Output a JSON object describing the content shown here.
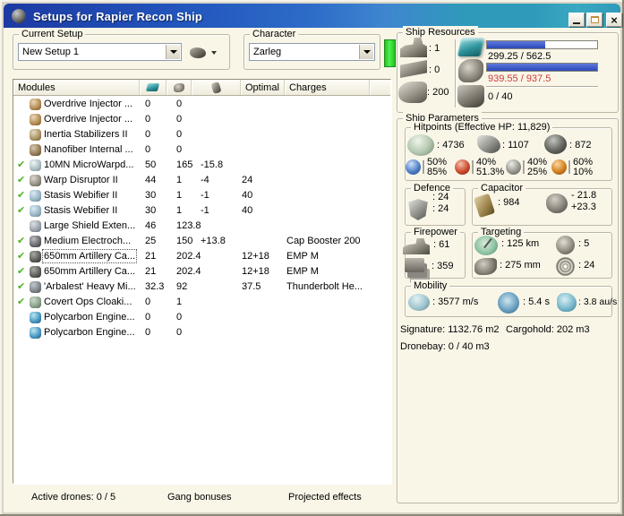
{
  "glyphs": {
    "check": "✔",
    "close": "×"
  },
  "window": {
    "title": "Setups for Rapier Recon Ship"
  },
  "setup_panel": {
    "label": "Current Setup",
    "value": "New Setup 1"
  },
  "character_panel": {
    "label": "Character",
    "value": "Zarleg"
  },
  "modules_table": {
    "header": {
      "modules": "Modules",
      "optimal": "Optimal",
      "charges": "Charges"
    },
    "rows": [
      {
        "icon": "overdrive-injector",
        "name": "Overdrive Injector ...",
        "cpu": "0",
        "pg": "0",
        "cap": "",
        "optimal": "",
        "charges": "",
        "active": false
      },
      {
        "icon": "overdrive-injector",
        "name": "Overdrive Injector ...",
        "cpu": "0",
        "pg": "0",
        "cap": "",
        "optimal": "",
        "charges": "",
        "active": false
      },
      {
        "icon": "inertia-stabilizers",
        "name": "Inertia Stabilizers II",
        "cpu": "0",
        "pg": "0",
        "cap": "",
        "optimal": "",
        "charges": "",
        "active": false
      },
      {
        "icon": "nanofiber-structure",
        "name": "Nanofiber Internal ...",
        "cpu": "0",
        "pg": "0",
        "cap": "",
        "optimal": "",
        "charges": "",
        "active": false
      },
      {
        "icon": "microwarpdrive",
        "name": "10MN MicroWarpd...",
        "cpu": "50",
        "pg": "165",
        "cap": "-15.8",
        "optimal": "",
        "charges": "",
        "active": true
      },
      {
        "icon": "warp-disruptor",
        "name": "Warp Disruptor II",
        "cpu": "44",
        "pg": "1",
        "cap": "-4",
        "optimal": "24",
        "charges": "",
        "active": true
      },
      {
        "icon": "stasis-webifier",
        "name": "Stasis Webifier II",
        "cpu": "30",
        "pg": "1",
        "cap": "-1",
        "optimal": "40",
        "charges": "",
        "active": true
      },
      {
        "icon": "stasis-webifier",
        "name": "Stasis Webifier II",
        "cpu": "30",
        "pg": "1",
        "cap": "-1",
        "optimal": "40",
        "charges": "",
        "active": true
      },
      {
        "icon": "shield-extender",
        "name": "Large Shield Exten...",
        "cpu": "46",
        "pg": "123.8",
        "cap": "",
        "optimal": "",
        "charges": "",
        "active": false
      },
      {
        "icon": "cap-booster",
        "name": "Medium Electroch...",
        "cpu": "25",
        "pg": "150",
        "cap": "+13.8",
        "optimal": "",
        "charges": "Cap Booster 200",
        "active": true
      },
      {
        "icon": "artillery",
        "name": "650mm Artillery Ca...",
        "cpu": "21",
        "pg": "202.4",
        "cap": "",
        "optimal": "12+18",
        "charges": "EMP M",
        "active": true,
        "selected": true
      },
      {
        "icon": "artillery",
        "name": "650mm Artillery Ca...",
        "cpu": "21",
        "pg": "202.4",
        "cap": "",
        "optimal": "12+18",
        "charges": "EMP M",
        "active": true
      },
      {
        "icon": "missile-launcher",
        "name": "'Arbalest' Heavy Mi...",
        "cpu": "32.3",
        "pg": "92",
        "cap": "",
        "optimal": "37.5",
        "charges": "Thunderbolt He...",
        "active": true
      },
      {
        "icon": "cloaking-device",
        "name": "Covert Ops Cloaki...",
        "cpu": "0",
        "pg": "1",
        "cap": "",
        "optimal": "",
        "charges": "",
        "active": true
      },
      {
        "icon": "polycarbon-rig",
        "name": "Polycarbon Engine...",
        "cpu": "0",
        "pg": "0",
        "cap": "",
        "optimal": "",
        "charges": "",
        "active": false
      },
      {
        "icon": "polycarbon-rig",
        "name": "Polycarbon Engine...",
        "cpu": "0",
        "pg": "0",
        "cap": "",
        "optimal": "",
        "charges": "",
        "active": false
      }
    ]
  },
  "ship_resources": {
    "title": "Ship Resources",
    "turrets": ": 1",
    "launchers": ": 0",
    "calibration": ": 200",
    "cpu": {
      "text": "299.25 / 562.5",
      "pct": 53
    },
    "powergrid": {
      "text": "939.55 / 937.5",
      "pct": 100
    },
    "drones": "0 / 40"
  },
  "ship_parameters": {
    "title": "Ship Parameters",
    "hitpoints": {
      "title": "Hitpoints (Effective HP: 11,829)",
      "shield": ": 4736",
      "armor": ": 1107",
      "structure": ": 872",
      "resists": [
        {
          "name": "em",
          "top": "50%",
          "bottom": "85%"
        },
        {
          "name": "explosive",
          "top": "40%",
          "bottom": "51.3%"
        },
        {
          "name": "kinetic",
          "top": "40%",
          "bottom": "25%"
        },
        {
          "name": "thermal",
          "top": "60%",
          "bottom": "10%"
        }
      ]
    },
    "defence": {
      "title": "Defence",
      "top": ": 24",
      "bottom": ": 24"
    },
    "capacitor": {
      "title": "Capacitor",
      "amount": ": 984",
      "drain": "- 21.8",
      "recharge": "+23.3"
    },
    "firepower": {
      "title": "Firepower",
      "volley": ": 61",
      "dps": ": 359"
    },
    "targeting": {
      "title": "Targeting",
      "range": ": 125 km",
      "max_targets": ": 5",
      "scan_res": ": 275 mm",
      "sensor_strength": ": 24"
    },
    "mobility": {
      "title": "Mobility",
      "speed": ": 3577 m/s",
      "align_time": ": 5.4 s",
      "warp_speed": ": 3.8 au/s"
    },
    "signature": "Signature: 1132.76 m2",
    "cargohold": "Cargohold: 202 m3",
    "dronebay": "Dronebay: 0 / 40 m3"
  },
  "footer": {
    "active_drones": "Active drones: 0 / 5",
    "gang_bonuses": "Gang bonuses",
    "projected_effects": "Projected effects"
  }
}
